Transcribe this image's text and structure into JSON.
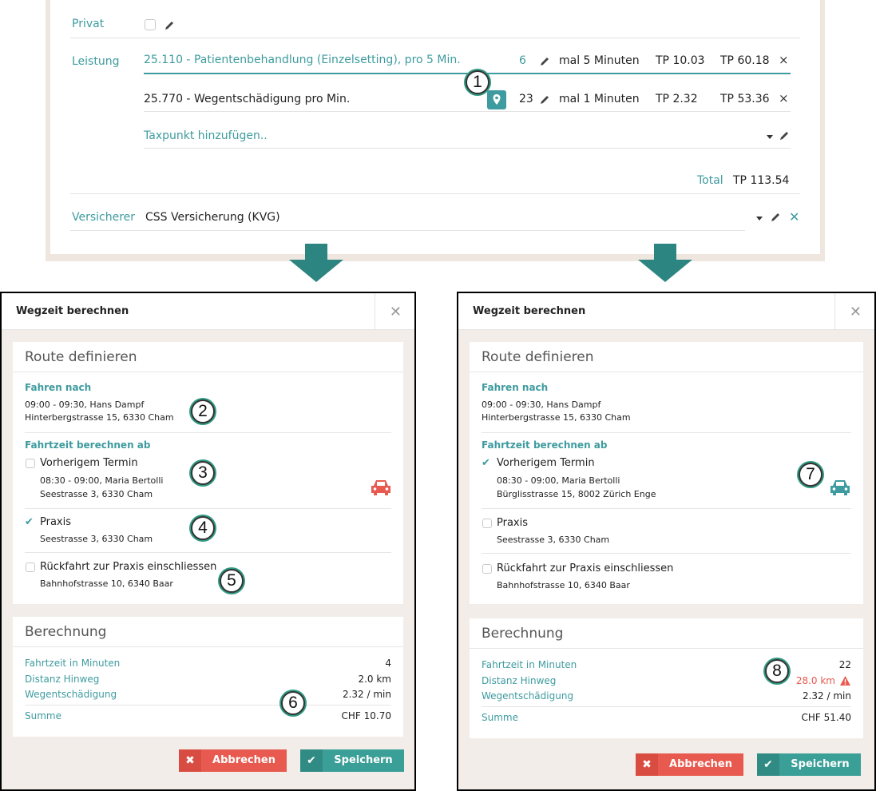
{
  "form": {
    "privat_label": "Privat",
    "leistung_label": "Leistung",
    "leistung_rows": [
      {
        "description": "25.110 - Patientenbehandlung (Einzelsetting), pro 5 Min.",
        "qty": "6",
        "unit": "mal 5 Minuten",
        "tp": "TP 10.03",
        "total": "TP 60.18",
        "remove": "×"
      },
      {
        "description": "25.770 - Wegentschädigung pro Min.",
        "qty": "23",
        "unit": "mal 1 Minuten",
        "tp": "TP 2.32",
        "total": "TP 53.36",
        "remove": "×"
      }
    ],
    "add_taxpunkt": "Taxpunkt hinzufügen..",
    "total_label": "Total",
    "total_value": "TP 113.54",
    "versicherer_label": "Versicherer",
    "versicherer_value": "CSS Versicherung (KVG)",
    "versicherer_clear": "✕"
  },
  "badges": [
    "1",
    "2",
    "3",
    "4",
    "5",
    "6",
    "7",
    "8"
  ],
  "colors": {
    "accent": "#3e9b9f",
    "danger": "#e85a4f",
    "badge_ring": "#2f9a82",
    "arrow": "#2d8582"
  },
  "dialogs": [
    {
      "title": "Wegzeit berechnen",
      "close": "✕",
      "route_title": "Route definieren",
      "fahren_nach_label": "Fahren nach",
      "fahren_nach_time": "09:00 - 09:30, Hans Dampf",
      "fahren_nach_addr": "Hinterbergstrasse 15, 6330 Cham",
      "ab_label": "Fahrtzeit berechnen ab",
      "options": [
        {
          "label": "Vorherigem Termin",
          "checked": false,
          "line1": "08:30 - 09:00, Maria Bertolli",
          "line2": "Seestrasse 3, 6330 Cham"
        },
        {
          "label": "Praxis",
          "checked": true,
          "line1": "Seestrasse 3, 6330 Cham",
          "line2": ""
        },
        {
          "label": "Rückfahrt zur Praxis einschliessen",
          "checked": false,
          "line1": "Bahnhofstrasse 10, 6340 Baar",
          "line2": ""
        }
      ],
      "car_icon": "car-icon",
      "car_color": "#e85a4f",
      "calc_title": "Berechnung",
      "calc_rows": [
        {
          "label": "Fahrtzeit in Minuten",
          "value": "4"
        },
        {
          "label": "Distanz Hinweg",
          "value": "2.0 km"
        },
        {
          "label": "Wegentschädigung",
          "value": "2.32 / min"
        },
        {
          "label": "Summe",
          "value": "CHF 10.70"
        }
      ],
      "cancel_label": "Abbrechen",
      "save_label": "Speichern"
    },
    {
      "title": "Wegzeit berechnen",
      "close": "✕",
      "route_title": "Route definieren",
      "fahren_nach_label": "Fahren nach",
      "fahren_nach_time": "09:00 - 09:30, Hans Dampf",
      "fahren_nach_addr": "Hinterbergstrasse 15, 6330 Cham",
      "ab_label": "Fahrtzeit berechnen ab",
      "options": [
        {
          "label": "Vorherigem Termin",
          "checked": true,
          "line1": "08:30 - 09:00, Maria Bertolli",
          "line2": "Bürglisstrasse 15, 8002 Zürich Enge"
        },
        {
          "label": "Praxis",
          "checked": false,
          "line1": "Seestrasse 3, 6330 Cham",
          "line2": ""
        },
        {
          "label": "Rückfahrt zur Praxis einschliessen",
          "checked": false,
          "line1": "Bahnhofstrasse 10, 6340 Baar",
          "line2": ""
        }
      ],
      "car_icon": "car-icon",
      "car_color": "#3e9b9f",
      "calc_title": "Berechnung",
      "calc_rows": [
        {
          "label": "Fahrtzeit in Minuten",
          "value": "22"
        },
        {
          "label": "Distanz Hinweg",
          "value": "28.0 km"
        },
        {
          "label": "Wegentschädigung",
          "value": "2.32 / min"
        },
        {
          "label": "Summe",
          "value": "CHF 51.40"
        }
      ],
      "cancel_label": "Abbrechen",
      "save_label": "Speichern"
    }
  ]
}
